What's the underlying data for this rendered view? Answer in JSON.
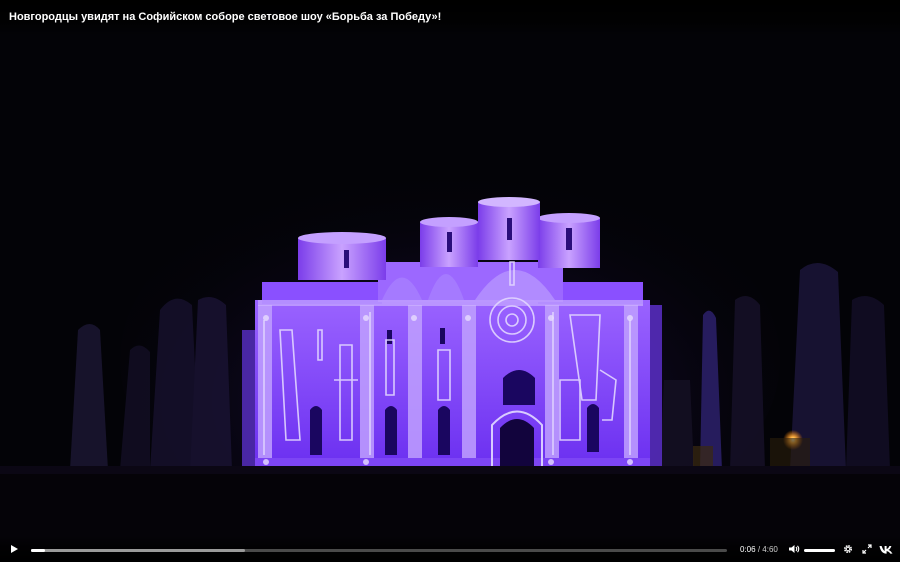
{
  "video": {
    "title": "Новгородцы увидят на Софийском соборе световое шоу «Борьба за Победу»!",
    "scene": "projection-mapping-light-show-on-cathedral"
  },
  "controls": {
    "current_time": "0:06",
    "separator": "/",
    "duration": "4:60",
    "progress_fraction": 0.02,
    "buffered_fraction": 0.307,
    "volume_fraction": 1.0,
    "icons": {
      "play": "play-icon",
      "volume": "volume-icon",
      "settings": "gear-icon",
      "fullscreen": "fullscreen-icon",
      "logo": "vk-logo-icon"
    }
  },
  "colors": {
    "projection": "#7a3cff",
    "projection_light": "#b48cff",
    "line_art": "#d9ccff",
    "background": "#020205"
  }
}
